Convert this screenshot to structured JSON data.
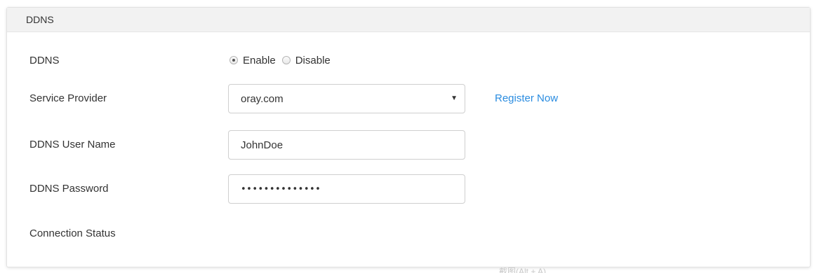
{
  "panel": {
    "title": "DDNS"
  },
  "ddns": {
    "label": "DDNS",
    "options": [
      "Enable",
      "Disable"
    ],
    "selected": "Enable"
  },
  "service_provider": {
    "label": "Service Provider",
    "value": "oray.com",
    "link_label": "Register Now"
  },
  "user_name": {
    "label": "DDNS User Name",
    "value": "JohnDoe"
  },
  "password": {
    "label": "DDNS Password",
    "masked_value": "••••••••••••••"
  },
  "connection_status": {
    "label": "Connection Status"
  },
  "footer_hint": {
    "text": "截图(Alt + A)"
  }
}
